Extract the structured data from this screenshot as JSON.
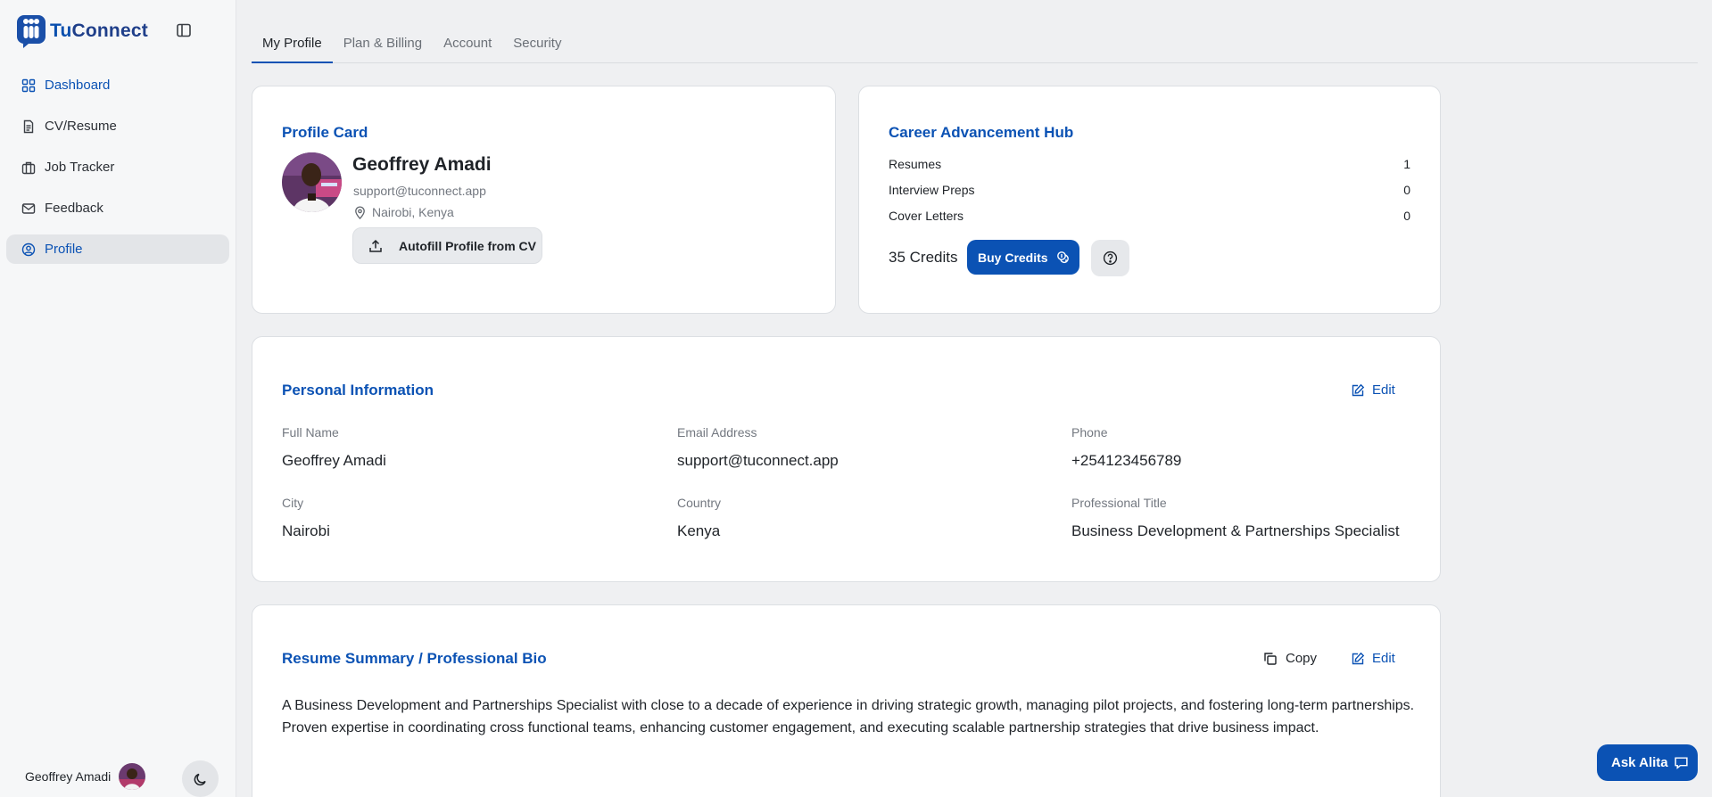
{
  "app": {
    "brand_part1": "Tu",
    "brand_part2": "Connect"
  },
  "sidebar": {
    "items": [
      {
        "label": "Dashboard",
        "icon": "dashboard-icon"
      },
      {
        "label": "CV/Resume",
        "icon": "document-icon"
      },
      {
        "label": "Job Tracker",
        "icon": "briefcase-icon"
      },
      {
        "label": "Feedback",
        "icon": "mail-icon"
      },
      {
        "label": "Profile",
        "icon": "user-circle-icon"
      }
    ],
    "active": "Profile",
    "user_name": "Geoffrey Amadi"
  },
  "tabs": [
    {
      "label": "My Profile"
    },
    {
      "label": "Plan & Billing"
    },
    {
      "label": "Account"
    },
    {
      "label": "Security"
    }
  ],
  "profile_card": {
    "title": "Profile Card",
    "name": "Geoffrey Amadi",
    "email": "support@tuconnect.app",
    "location": "Nairobi, Kenya",
    "autofill_label": "Autofill Profile from CV"
  },
  "career_hub": {
    "title": "Career Advancement Hub",
    "stats": [
      {
        "label": "Resumes",
        "value": "1"
      },
      {
        "label": "Interview Preps",
        "value": "0"
      },
      {
        "label": "Cover Letters",
        "value": "0"
      }
    ],
    "credits": "35 Credits",
    "buy_label": "Buy Credits"
  },
  "personal_info": {
    "title": "Personal Information",
    "edit_label": "Edit",
    "fields": [
      {
        "label": "Full Name",
        "value": "Geoffrey Amadi"
      },
      {
        "label": "Email Address",
        "value": "support@tuconnect.app"
      },
      {
        "label": "Phone",
        "value": "+254123456789"
      },
      {
        "label": "City",
        "value": "Nairobi"
      },
      {
        "label": "Country",
        "value": "Kenya"
      },
      {
        "label": "Professional Title",
        "value": "Business Development & Partnerships Specialist"
      }
    ]
  },
  "bio": {
    "title": "Resume Summary / Professional Bio",
    "copy_label": "Copy",
    "edit_label": "Edit",
    "text": "A Business Development and Partnerships Specialist with close to a decade of experience in driving strategic growth, managing pilot projects, and fostering long-term partnerships. Proven expertise in coordinating cross functional teams, enhancing customer engagement, and executing scalable partnership strategies that drive business impact."
  },
  "assistant": {
    "label": "Ask Alita"
  },
  "colors": {
    "accent": "#0b52b4",
    "background": "#eff0f2",
    "card": "#ffffff"
  }
}
